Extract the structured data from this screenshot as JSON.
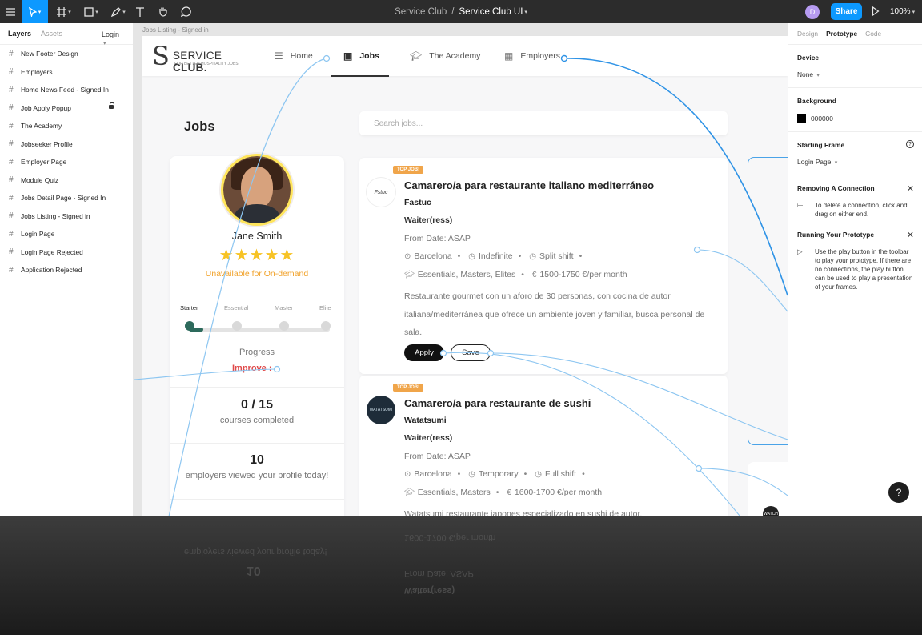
{
  "toolbar": {
    "file_project": "Service Club",
    "file_separator": "/",
    "file_name": "Service Club UI",
    "avatar_initial": "D",
    "share_label": "Share",
    "zoom": "100%"
  },
  "left_panel": {
    "tab_layers": "Layers",
    "tab_assets": "Assets",
    "page": "Login",
    "layers": [
      {
        "label": "New Footer Design"
      },
      {
        "label": "Employers"
      },
      {
        "label": "Home News Feed - Signed In"
      },
      {
        "label": "Job Apply Popup",
        "locked": true
      },
      {
        "label": "The Academy"
      },
      {
        "label": "Jobseeker Profile"
      },
      {
        "label": "Employer Page"
      },
      {
        "label": "Module Quiz"
      },
      {
        "label": "Jobs Detail Page - Signed In"
      },
      {
        "label": "Jobs Listing - Signed in"
      },
      {
        "label": "Login Page"
      },
      {
        "label": "Login Page Rejected"
      },
      {
        "label": "Application Rejected"
      }
    ]
  },
  "right_panel": {
    "tab_design": "Design",
    "tab_prototype": "Prototype",
    "tab_code": "Code",
    "device_heading": "Device",
    "device_value": "None",
    "background_heading": "Background",
    "background_value": "000000",
    "starting_frame_heading": "Starting Frame",
    "starting_frame_value": "Login Page",
    "removing_heading": "Removing A Connection",
    "removing_text": "To delete a connection, click and drag on either end.",
    "running_heading": "Running Your Prototype",
    "running_text": "Use the play button in the toolbar to play your prototype. If there are no connections, the play button can be used to play a presentation of your frames."
  },
  "canvas": {
    "frame_label": "Jobs Listing - Signed in",
    "help": "?",
    "watch_label": "WATCH"
  },
  "site": {
    "logo_name_light": "SERVICE ",
    "logo_name_bold": "CLUB.",
    "logo_tagline": "FOR BETTER HOSPITALITY JOBS",
    "nav": {
      "home": "Home",
      "jobs": "Jobs",
      "academy": "The Academy",
      "employers": "Employers"
    },
    "page_title": "Jobs",
    "search_placeholder": "Search jobs..."
  },
  "profile": {
    "name": "Jane Smith",
    "stars": "★★★★★",
    "rating": 5,
    "status": "Unavailable for On-demand",
    "levels": [
      "Starter",
      "Essential",
      "Master",
      "Elite"
    ],
    "progress_fraction": 0.1,
    "progress_label": "Progress",
    "improve_label": "Improve :",
    "courses_value": "0 / 15",
    "courses_caption": "courses completed",
    "views_value": "10",
    "views_caption": "employers viewed your profile today!"
  },
  "jobs": [
    {
      "badge": "TOP JOB!",
      "logo_text": "Fstuc",
      "title": "Camarero/a para restaurante italiano mediterráneo",
      "company": "Fastuc",
      "role": "Waiter(ress)",
      "from_date": "From Date: ASAP",
      "city": "Barcelona",
      "contract": "Indefinite",
      "shift": "Split shift",
      "levels": "Essentials, Masters, Elites",
      "salary": "1500-1750 €/per month",
      "description": "Restaurante gourmet con un aforo de 30 personas, con cocina de autor italiana/mediterránea que ofrece un ambiente joven y familiar, busca personal de sala.",
      "apply_label": "Apply",
      "save_label": "Save"
    },
    {
      "badge": "TOP JOB!",
      "logo_text": "WATATSUMI",
      "title": "Camarero/a para restaurante de sushi",
      "company": "Watatsumi",
      "role": "Waiter(ress)",
      "from_date": "From Date: ASAP",
      "city": "Barcelona",
      "contract": "Temporary",
      "shift": "Full shift",
      "levels": "Essentials, Masters",
      "salary": "1600-1700 €/per month",
      "description": "Watatsumi restaurante japones especializado en sushi de autor,"
    }
  ],
  "colors": {
    "accent": "#0d99ff",
    "toolbar": "#2c2c2c",
    "star": "#f7c325",
    "unavailable": "#f1a22a",
    "badge": "#f0a54a",
    "progress": "#2d6a5c",
    "improve": "#e04a4a"
  }
}
